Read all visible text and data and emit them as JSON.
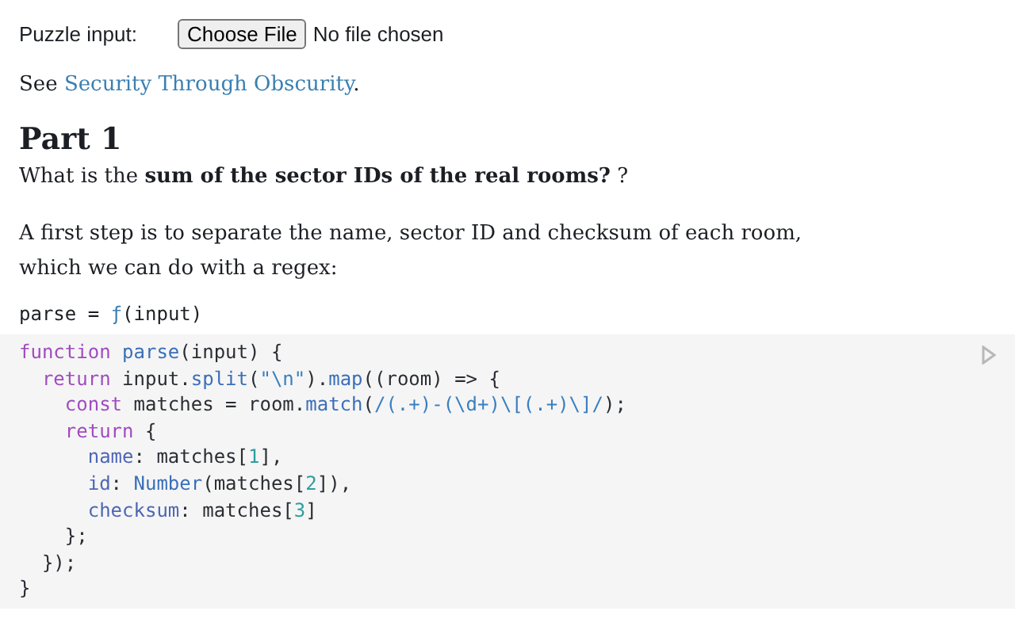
{
  "file_input": {
    "label": "Puzzle input:",
    "button": "Choose File",
    "status": "No file chosen"
  },
  "see": {
    "prefix": "See ",
    "link": "Security Through Obscurity",
    "suffix": "."
  },
  "heading": "Part 1",
  "question": "What is the **sum of the sector IDs of the real rooms?** ?",
  "paragraph": "A first step is to separate the name, sector ID and checksum of each room, which we can do with a regex:",
  "cell_output": {
    "name": "parse",
    "equals": " = ",
    "fn": "ƒ",
    "args": "(input)"
  },
  "code": [
    {
      "tokens": [
        {
          "text": "function",
          "kind": "keyword"
        },
        {
          "text": " parse",
          "kind": "def"
        },
        {
          "text": "(input) {",
          "kind": "plain"
        }
      ]
    },
    {
      "tokens": [
        {
          "text": "  return",
          "kind": "keyword"
        },
        {
          "text": " input.",
          "kind": "plain"
        },
        {
          "text": "split",
          "kind": "def"
        },
        {
          "text": "(",
          "kind": "plain"
        },
        {
          "text": "\"\\n\"",
          "kind": "string"
        },
        {
          "text": ").",
          "kind": "plain"
        },
        {
          "text": "map",
          "kind": "def"
        },
        {
          "text": "((room) => {",
          "kind": "plain"
        }
      ]
    },
    {
      "tokens": [
        {
          "text": "    const",
          "kind": "keyword"
        },
        {
          "text": " matches = room.",
          "kind": "plain"
        },
        {
          "text": "match",
          "kind": "def"
        },
        {
          "text": "(",
          "kind": "plain"
        },
        {
          "text": "/(.+)-(\\d+)\\[(.+)\\]/",
          "kind": "string"
        },
        {
          "text": ");",
          "kind": "plain"
        }
      ]
    },
    {
      "tokens": [
        {
          "text": "    return",
          "kind": "keyword"
        },
        {
          "text": " {",
          "kind": "plain"
        }
      ]
    },
    {
      "tokens": [
        {
          "text": "      name",
          "kind": "property"
        },
        {
          "text": ": matches[",
          "kind": "plain"
        },
        {
          "text": "1",
          "kind": "number"
        },
        {
          "text": "],",
          "kind": "plain"
        }
      ]
    },
    {
      "tokens": [
        {
          "text": "      id",
          "kind": "property"
        },
        {
          "text": ": ",
          "kind": "plain"
        },
        {
          "text": "Number",
          "kind": "def"
        },
        {
          "text": "(matches[",
          "kind": "plain"
        },
        {
          "text": "2",
          "kind": "number"
        },
        {
          "text": "]),",
          "kind": "plain"
        }
      ]
    },
    {
      "tokens": [
        {
          "text": "      checksum",
          "kind": "property"
        },
        {
          "text": ": matches[",
          "kind": "plain"
        },
        {
          "text": "3",
          "kind": "number"
        },
        {
          "text": "]",
          "kind": "plain"
        }
      ]
    },
    {
      "tokens": [
        {
          "text": "    };",
          "kind": "plain"
        }
      ]
    },
    {
      "tokens": [
        {
          "text": "  });",
          "kind": "plain"
        }
      ]
    },
    {
      "tokens": [
        {
          "text": "}",
          "kind": "plain"
        }
      ]
    }
  ]
}
